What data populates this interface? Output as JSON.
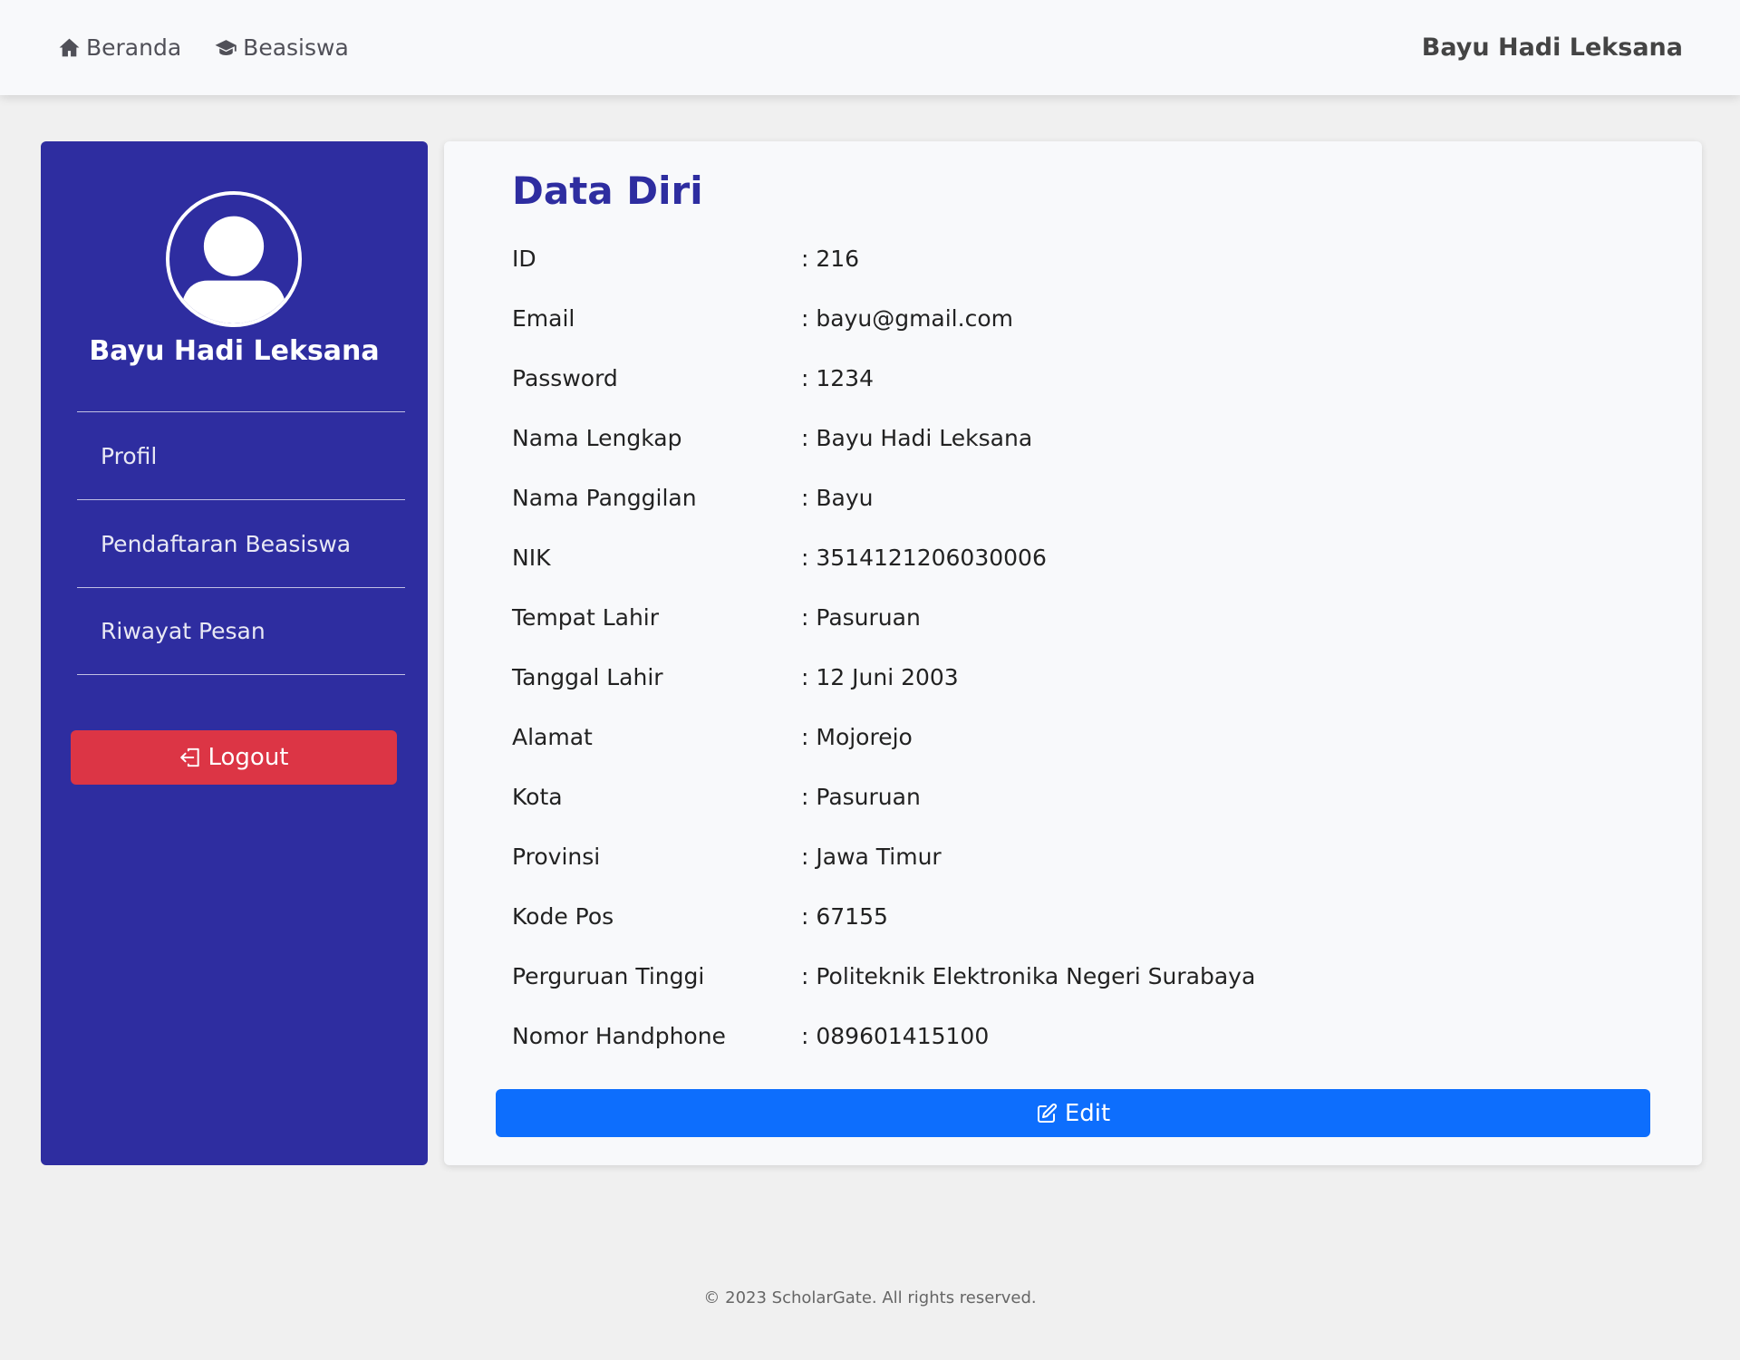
{
  "nav": {
    "home_label": "Beranda",
    "scholarship_label": "Beasiswa",
    "user_name": "Bayu Hadi Leksana"
  },
  "sidebar": {
    "name": "Bayu Hadi Leksana",
    "items": [
      {
        "label": "Profil"
      },
      {
        "label": "Pendaftaran Beasiswa"
      },
      {
        "label": "Riwayat Pesan"
      }
    ],
    "logout_label": "Logout"
  },
  "profile": {
    "title": "Data Diri",
    "rows": [
      {
        "label": "ID",
        "value": ": 216"
      },
      {
        "label": "Email",
        "value": ": bayu@gmail.com"
      },
      {
        "label": "Password",
        "value": ": 1234"
      },
      {
        "label": "Nama Lengkap",
        "value": ": Bayu Hadi Leksana"
      },
      {
        "label": "Nama Panggilan",
        "value": ": Bayu"
      },
      {
        "label": "NIK",
        "value": ": 3514121206030006"
      },
      {
        "label": "Tempat Lahir",
        "value": ": Pasuruan"
      },
      {
        "label": "Tanggal Lahir",
        "value": ": 12 Juni 2003"
      },
      {
        "label": "Alamat",
        "value": ": Mojorejo"
      },
      {
        "label": "Kota",
        "value": ": Pasuruan"
      },
      {
        "label": "Provinsi",
        "value": ": Jawa Timur"
      },
      {
        "label": "Kode Pos",
        "value": ": 67155"
      },
      {
        "label": "Perguruan Tinggi",
        "value": ": Politeknik Elektronika Negeri Surabaya"
      },
      {
        "label": "Nomor Handphone",
        "value": ": 089601415100"
      }
    ],
    "edit_label": "Edit"
  },
  "footer": {
    "text": "© 2023 ScholarGate. All rights reserved."
  },
  "colors": {
    "primary": "#2e2da0",
    "danger": "#dc3545",
    "button_blue": "#0d6efd",
    "background": "#f0f0f0"
  }
}
